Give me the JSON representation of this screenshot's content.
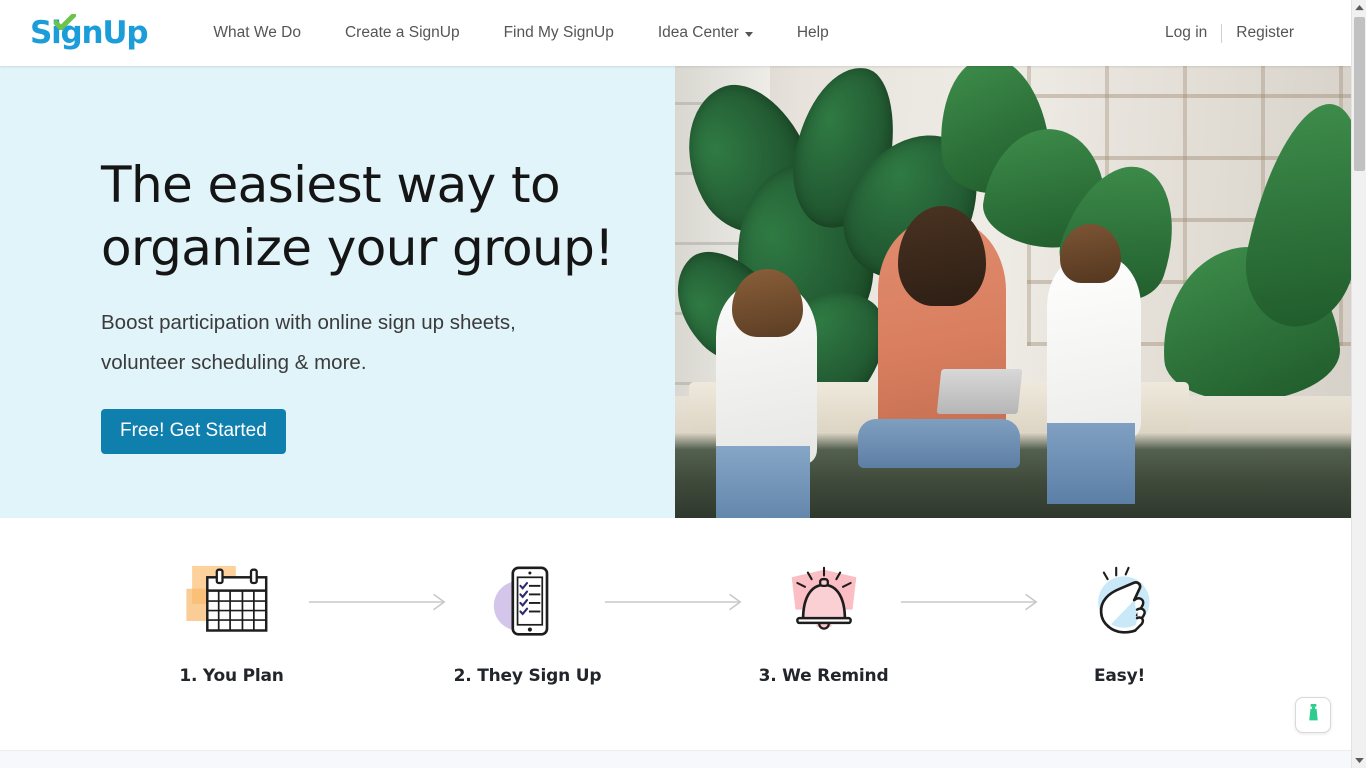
{
  "brand": {
    "logo_text": "SignUp",
    "logo_color": "#1b9dd9",
    "check_color": "#6cc24a"
  },
  "header": {
    "nav": [
      {
        "label": "What We Do",
        "has_dropdown": false
      },
      {
        "label": "Create a SignUp",
        "has_dropdown": false
      },
      {
        "label": "Find My SignUp",
        "has_dropdown": false
      },
      {
        "label": "Idea Center",
        "has_dropdown": true
      },
      {
        "label": "Help",
        "has_dropdown": false
      }
    ],
    "login_label": "Log in",
    "register_label": "Register"
  },
  "hero": {
    "title_line1": "The easiest way to",
    "title_line2": "organize your group!",
    "subtitle": "Boost participation with online sign up sheets, volunteer scheduling & more.",
    "cta_label": "Free! Get Started",
    "cta_color": "#0f7fae",
    "background_color": "#e0f4fa",
    "image_alt": "Mother with laptop and two children sitting on a bench surrounded by houseplants"
  },
  "steps": {
    "items": [
      {
        "label": "1. You Plan",
        "icon": "calendar-icon",
        "accent_color": "#f9bf7f"
      },
      {
        "label": "2. They Sign Up",
        "icon": "mobile-checklist-icon",
        "accent_color": "#cdbce8"
      },
      {
        "label": "3. We Remind",
        "icon": "alarm-bell-icon",
        "accent_color": "#f8a3ab"
      },
      {
        "label": "Easy!",
        "icon": "snapping-fingers-icon",
        "accent_color": "#bfe5f7"
      }
    ],
    "arrow_icon": "arrow-right-icon"
  },
  "widget": {
    "icon": "lighthouse-beacon-icon",
    "color": "#2ecc8f"
  },
  "scrollbar": {
    "up_icon": "caret-up-icon",
    "down_icon": "caret-down-icon"
  }
}
